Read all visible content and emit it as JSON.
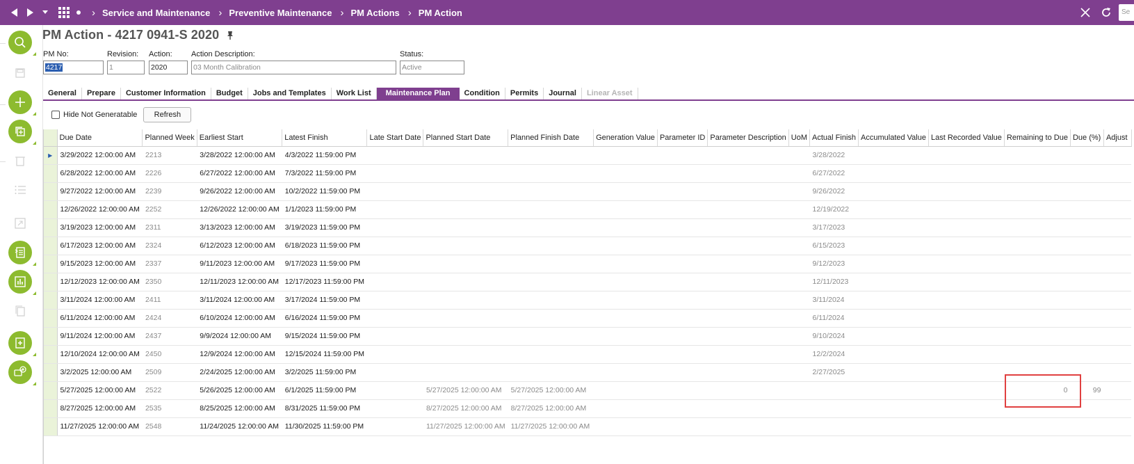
{
  "breadcrumb": {
    "items": [
      "Service and Maintenance",
      "Preventive Maintenance",
      "PM Actions",
      "PM Action"
    ]
  },
  "top_search_placeholder": "Se",
  "page": {
    "title": "PM Action - 4217 0941-S 2020"
  },
  "form": {
    "pm_no": {
      "label": "PM No:",
      "value": "4217"
    },
    "revision": {
      "label": "Revision:",
      "value": "1"
    },
    "action": {
      "label": "Action:",
      "value": "2020"
    },
    "action_description": {
      "label": "Action Description:",
      "value": "03 Month Calibration"
    },
    "status": {
      "label": "Status:",
      "value": "Active"
    }
  },
  "tabs": [
    {
      "label": "General",
      "state": "normal"
    },
    {
      "label": "Prepare",
      "state": "normal"
    },
    {
      "label": "Customer Information",
      "state": "normal"
    },
    {
      "label": "Budget",
      "state": "normal"
    },
    {
      "label": "Jobs and Templates",
      "state": "normal"
    },
    {
      "label": "Work List",
      "state": "normal"
    },
    {
      "label": "Maintenance Plan",
      "state": "active"
    },
    {
      "label": "Condition",
      "state": "normal"
    },
    {
      "label": "Permits",
      "state": "normal"
    },
    {
      "label": "Journal",
      "state": "normal"
    },
    {
      "label": "Linear Asset",
      "state": "disabled"
    }
  ],
  "options": {
    "hide_not_generatable": {
      "label": "Hide Not Generatable",
      "checked": false
    },
    "refresh_label": "Refresh"
  },
  "grid": {
    "columns": [
      "Due Date",
      "Planned Week",
      "Earliest Start",
      "Latest Finish",
      "Late Start Date",
      "Planned Start Date",
      "Planned Finish Date",
      "Generation Value",
      "Parameter ID",
      "Parameter Description",
      "UoM",
      "Actual Finish",
      "Accumulated Value",
      "Last Recorded Value",
      "Remaining to Due",
      "Due (%)",
      "Adjust"
    ],
    "rows": [
      {
        "due_date": "3/29/2022 12:00:00 AM",
        "planned_week": "2213",
        "earliest_start": "3/28/2022 12:00:00 AM",
        "latest_finish": "4/3/2022 11:59:00 PM",
        "planned_start": "",
        "planned_finish": "",
        "actual_finish": "3/28/2022",
        "remaining": "",
        "due_pct": ""
      },
      {
        "due_date": "6/28/2022 12:00:00 AM",
        "planned_week": "2226",
        "earliest_start": "6/27/2022 12:00:00 AM",
        "latest_finish": "7/3/2022 11:59:00 PM",
        "planned_start": "",
        "planned_finish": "",
        "actual_finish": "6/27/2022",
        "remaining": "",
        "due_pct": ""
      },
      {
        "due_date": "9/27/2022 12:00:00 AM",
        "planned_week": "2239",
        "earliest_start": "9/26/2022 12:00:00 AM",
        "latest_finish": "10/2/2022 11:59:00 PM",
        "planned_start": "",
        "planned_finish": "",
        "actual_finish": "9/26/2022",
        "remaining": "",
        "due_pct": ""
      },
      {
        "due_date": "12/26/2022 12:00:00 AM",
        "planned_week": "2252",
        "earliest_start": "12/26/2022 12:00:00 AM",
        "latest_finish": "1/1/2023 11:59:00 PM",
        "planned_start": "",
        "planned_finish": "",
        "actual_finish": "12/19/2022",
        "remaining": "",
        "due_pct": ""
      },
      {
        "due_date": "3/19/2023 12:00:00 AM",
        "planned_week": "2311",
        "earliest_start": "3/13/2023 12:00:00 AM",
        "latest_finish": "3/19/2023 11:59:00 PM",
        "planned_start": "",
        "planned_finish": "",
        "actual_finish": "3/17/2023",
        "remaining": "",
        "due_pct": ""
      },
      {
        "due_date": "6/17/2023 12:00:00 AM",
        "planned_week": "2324",
        "earliest_start": "6/12/2023 12:00:00 AM",
        "latest_finish": "6/18/2023 11:59:00 PM",
        "planned_start": "",
        "planned_finish": "",
        "actual_finish": "6/15/2023",
        "remaining": "",
        "due_pct": ""
      },
      {
        "due_date": "9/15/2023 12:00:00 AM",
        "planned_week": "2337",
        "earliest_start": "9/11/2023 12:00:00 AM",
        "latest_finish": "9/17/2023 11:59:00 PM",
        "planned_start": "",
        "planned_finish": "",
        "actual_finish": "9/12/2023",
        "remaining": "",
        "due_pct": ""
      },
      {
        "due_date": "12/12/2023 12:00:00 AM",
        "planned_week": "2350",
        "earliest_start": "12/11/2023 12:00:00 AM",
        "latest_finish": "12/17/2023 11:59:00 PM",
        "planned_start": "",
        "planned_finish": "",
        "actual_finish": "12/11/2023",
        "remaining": "",
        "due_pct": ""
      },
      {
        "due_date": "3/11/2024 12:00:00 AM",
        "planned_week": "2411",
        "earliest_start": "3/11/2024 12:00:00 AM",
        "latest_finish": "3/17/2024 11:59:00 PM",
        "planned_start": "",
        "planned_finish": "",
        "actual_finish": "3/11/2024",
        "remaining": "",
        "due_pct": ""
      },
      {
        "due_date": "6/11/2024 12:00:00 AM",
        "planned_week": "2424",
        "earliest_start": "6/10/2024 12:00:00 AM",
        "latest_finish": "6/16/2024 11:59:00 PM",
        "planned_start": "",
        "planned_finish": "",
        "actual_finish": "6/11/2024",
        "remaining": "",
        "due_pct": ""
      },
      {
        "due_date": "9/11/2024 12:00:00 AM",
        "planned_week": "2437",
        "earliest_start": "9/9/2024 12:00:00 AM",
        "latest_finish": "9/15/2024 11:59:00 PM",
        "planned_start": "",
        "planned_finish": "",
        "actual_finish": "9/10/2024",
        "remaining": "",
        "due_pct": ""
      },
      {
        "due_date": "12/10/2024 12:00:00 AM",
        "planned_week": "2450",
        "earliest_start": "12/9/2024 12:00:00 AM",
        "latest_finish": "12/15/2024 11:59:00 PM",
        "planned_start": "",
        "planned_finish": "",
        "actual_finish": "12/2/2024",
        "remaining": "",
        "due_pct": ""
      },
      {
        "due_date": "3/2/2025 12:00:00 AM",
        "planned_week": "2509",
        "earliest_start": "2/24/2025 12:00:00 AM",
        "latest_finish": "3/2/2025 11:59:00 PM",
        "planned_start": "",
        "planned_finish": "",
        "actual_finish": "2/27/2025",
        "remaining": "",
        "due_pct": ""
      },
      {
        "due_date": "5/27/2025 12:00:00 AM",
        "planned_week": "2522",
        "earliest_start": "5/26/2025 12:00:00 AM",
        "latest_finish": "6/1/2025 11:59:00 PM",
        "planned_start": "5/27/2025 12:00:00 AM",
        "planned_finish": "5/27/2025 12:00:00 AM",
        "actual_finish": "",
        "remaining": "0",
        "due_pct": "99"
      },
      {
        "due_date": "8/27/2025 12:00:00 AM",
        "planned_week": "2535",
        "earliest_start": "8/25/2025 12:00:00 AM",
        "latest_finish": "8/31/2025 11:59:00 PM",
        "planned_start": "8/27/2025 12:00:00 AM",
        "planned_finish": "8/27/2025 12:00:00 AM",
        "actual_finish": "",
        "remaining": "",
        "due_pct": ""
      },
      {
        "due_date": "11/27/2025 12:00:00 AM",
        "planned_week": "2548",
        "earliest_start": "11/24/2025 12:00:00 AM",
        "latest_finish": "11/30/2025 11:59:00 PM",
        "planned_start": "11/27/2025 12:00:00 AM",
        "planned_finish": "11/27/2025 12:00:00 AM",
        "actual_finish": "",
        "remaining": "",
        "due_pct": ""
      }
    ]
  },
  "colors": {
    "brand_purple": "#7f3f8f",
    "action_green": "#8dbb2f",
    "highlight_red": "#e04040"
  }
}
